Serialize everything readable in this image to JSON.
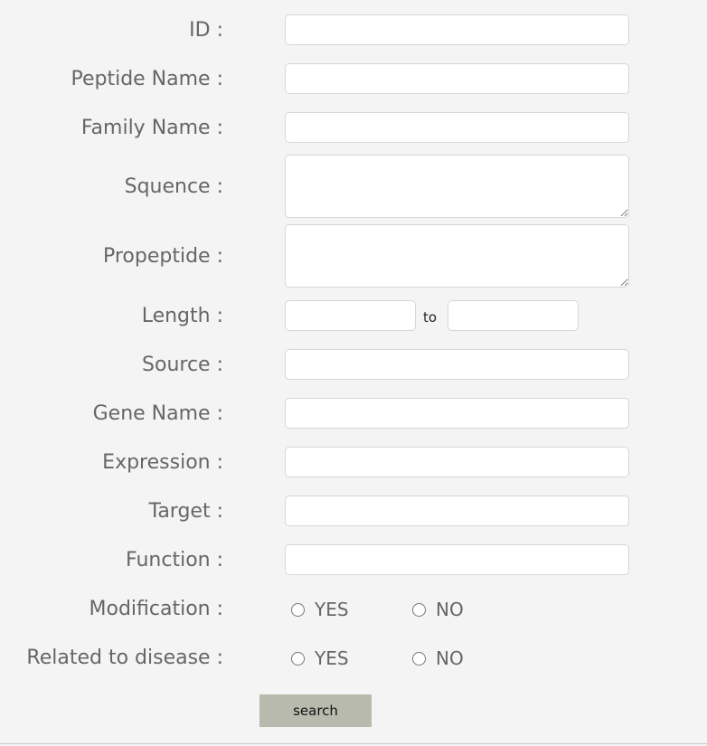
{
  "fields": {
    "id": {
      "label": "ID :",
      "value": ""
    },
    "peptide_name": {
      "label": "Peptide Name :",
      "value": ""
    },
    "family_name": {
      "label": "Family Name :",
      "value": ""
    },
    "sequence": {
      "label": "Squence :",
      "value": ""
    },
    "propeptide": {
      "label": "Propeptide :",
      "value": ""
    },
    "length": {
      "label": "Length :",
      "from_value": "",
      "to_label": "to",
      "to_value": ""
    },
    "source": {
      "label": "Source :",
      "value": ""
    },
    "gene_name": {
      "label": "Gene Name :",
      "value": ""
    },
    "expression": {
      "label": "Expression :",
      "value": ""
    },
    "target": {
      "label": "Target :",
      "value": ""
    },
    "function": {
      "label": "Function :",
      "value": ""
    },
    "modification": {
      "label": "Modification :",
      "yes_label": "YES",
      "no_label": "NO",
      "selected": null
    },
    "related_to_disease": {
      "label": "Related to disease :",
      "yes_label": "YES",
      "no_label": "NO",
      "selected": null
    }
  },
  "search_button": {
    "label": "search"
  },
  "colors": {
    "background": "#f4f4f4",
    "label_text": "#666666",
    "button_bg": "#b8baad",
    "input_border": "#d6d6d6"
  }
}
